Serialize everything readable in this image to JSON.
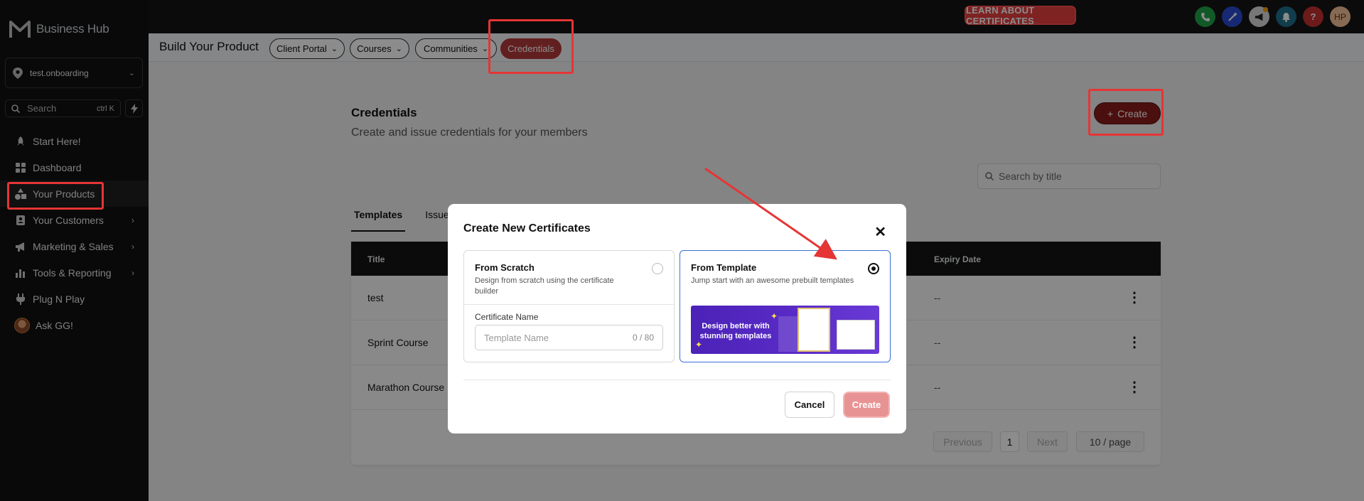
{
  "brand": {
    "name": "Business Hub"
  },
  "account": {
    "name": "test.onboarding"
  },
  "sidebar_search": {
    "placeholder": "Search",
    "shortcut": "ctrl K"
  },
  "nav": [
    {
      "label": "Start Here!",
      "icon": "rocket-icon"
    },
    {
      "label": "Dashboard",
      "icon": "dashboard-icon"
    },
    {
      "label": "Your Products",
      "icon": "shapes-icon"
    },
    {
      "label": "Your Customers",
      "icon": "contacts-icon"
    },
    {
      "label": "Marketing & Sales",
      "icon": "megaphone-icon"
    },
    {
      "label": "Tools & Reporting",
      "icon": "bar-chart-icon"
    },
    {
      "label": "Plug N Play",
      "icon": "plug-icon"
    },
    {
      "label": "Ask GG!",
      "icon": "avatar"
    }
  ],
  "topbar": {
    "learn_button": "LEARN ABOUT CERTIFICATES",
    "user_initials": "HP",
    "help": "?"
  },
  "subbar": {
    "title": "Build Your Product",
    "pills": [
      "Client Portal",
      "Courses",
      "Communities",
      "Credentials"
    ]
  },
  "credentials": {
    "title": "Credentials",
    "subtitle": "Create and issue credentials for your members",
    "create_label": "Create",
    "search_placeholder": "Search by title",
    "tabs": [
      "Templates",
      "Issue"
    ],
    "columns": {
      "title": "Title",
      "expiry": "Expiry Date"
    },
    "rows": [
      {
        "title": "test",
        "expiry": "--"
      },
      {
        "title": "Sprint Course",
        "expiry": "--"
      },
      {
        "title": "Marathon Course",
        "expiry": "--"
      }
    ],
    "pager": {
      "previous": "Previous",
      "page": "1",
      "next": "Next",
      "per_page": "10 / page"
    }
  },
  "modal": {
    "title": "Create New Certificates",
    "scratch": {
      "title": "From Scratch",
      "desc": "Design from scratch using the certificate builder",
      "field_label": "Certificate Name",
      "field_placeholder": "Template Name",
      "field_count": "0 / 80"
    },
    "template": {
      "title": "From Template",
      "desc": "Jump start with an awesome prebuilt templates",
      "promo_text": "Design better with stunning templates"
    },
    "cancel": "Cancel",
    "create": "Create"
  },
  "colors": {
    "accent": "#b33a3a",
    "highlight": "#e53535",
    "selected": "#3b6fd8"
  }
}
